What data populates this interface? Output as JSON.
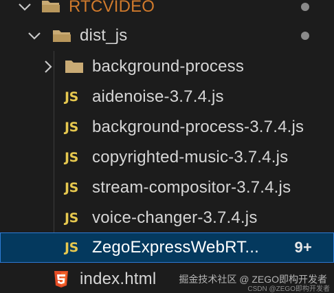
{
  "explorer": {
    "root": {
      "label": "RTCVIDEO",
      "expanded": true
    },
    "folder": {
      "label": "dist_js",
      "expanded": true
    },
    "items": [
      {
        "type": "folder",
        "label": "background-process",
        "icon": "folder-icon"
      },
      {
        "type": "js",
        "badge": "JS",
        "label": "aidenoise-3.7.4.js"
      },
      {
        "type": "js",
        "badge": "JS",
        "label": "background-process-3.7.4.js"
      },
      {
        "type": "js",
        "badge": "JS",
        "label": "copyrighted-music-3.7.4.js"
      },
      {
        "type": "js",
        "badge": "JS",
        "label": "stream-compositor-3.7.4.js"
      },
      {
        "type": "js",
        "badge": "JS",
        "label": "voice-changer-3.7.4.js"
      },
      {
        "type": "js",
        "badge": "JS",
        "label": "ZegoExpressWebRT...",
        "count": "9+",
        "selected": true
      }
    ],
    "html_file": {
      "label": "index.html",
      "icon": "html5-icon"
    }
  },
  "watermark": {
    "text": "掘金技术社区 @ ZEGO即构开发者",
    "sub": "CSDN @ZEGO即构开发者"
  },
  "colors": {
    "background": "#1c1c1c",
    "text": "#d6d6d6",
    "js_badge": "#e6c84f",
    "selected_bg": "#04395e",
    "selected_border": "#2e7bd6",
    "html_icon": "#e44d26",
    "folder_icon": "#c9ab75"
  }
}
